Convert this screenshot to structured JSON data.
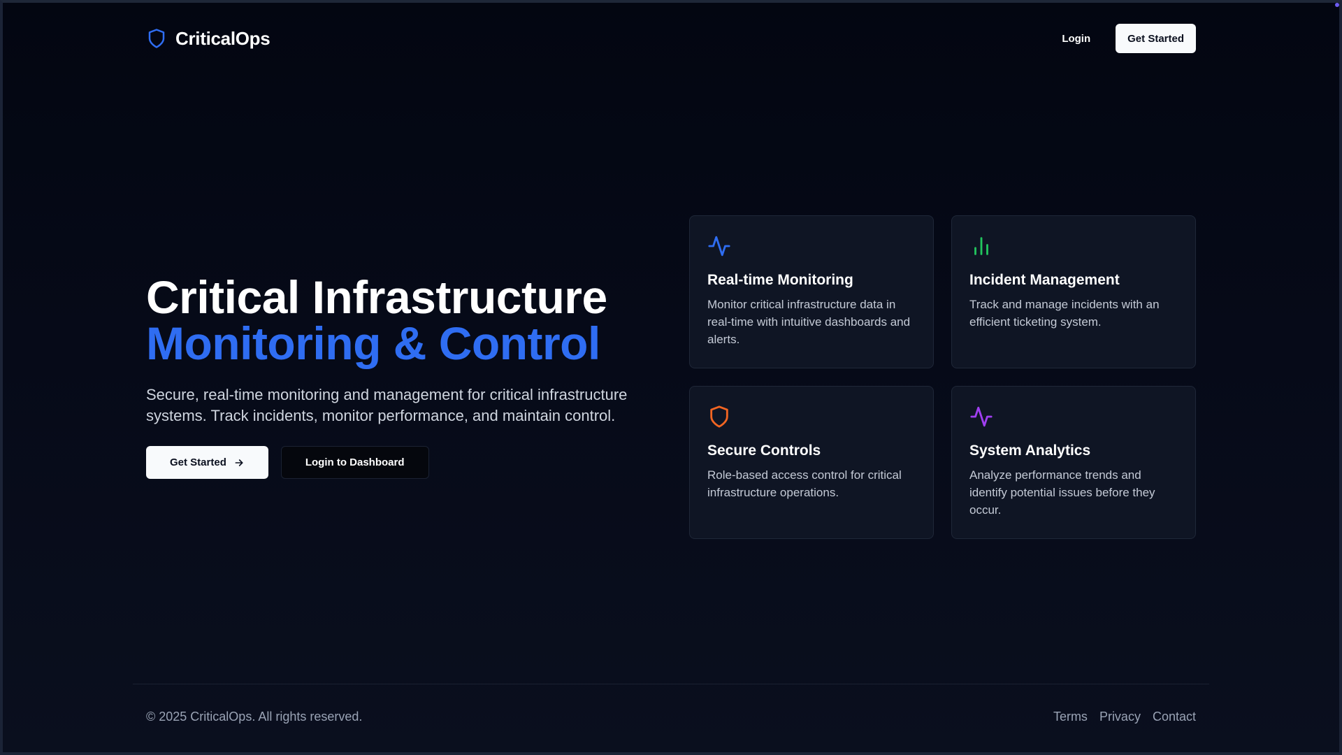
{
  "header": {
    "brand_name": "CriticalOps",
    "brand_icon": "shield-icon",
    "login_label": "Login",
    "get_started_label": "Get Started"
  },
  "hero": {
    "title_line1": "Critical Infrastructure",
    "title_line2": "Monitoring & Control",
    "subtitle": "Secure, real-time monitoring and management for critical infrastructure systems. Track incidents, monitor performance, and maintain control.",
    "primary_button": "Get Started",
    "primary_button_icon": "arrow-right-icon",
    "secondary_button": "Login to Dashboard"
  },
  "features": [
    {
      "icon": "activity-icon",
      "icon_color": "#2f6df2",
      "title": "Real-time Monitoring",
      "description": "Monitor critical infrastructure data in real-time with intuitive dashboards and alerts."
    },
    {
      "icon": "bar-chart-icon",
      "icon_color": "#22c55e",
      "title": "Incident Management",
      "description": "Track and manage incidents with an efficient ticketing system."
    },
    {
      "icon": "shield-icon",
      "icon_color": "#f26522",
      "title": "Secure Controls",
      "description": "Role-based access control for critical infrastructure operations."
    },
    {
      "icon": "activity-icon",
      "icon_color": "#a03ff0",
      "title": "System Analytics",
      "description": "Analyze performance trends and identify potential issues before they occur."
    }
  ],
  "footer": {
    "copyright": "© 2025 CriticalOps. All rights reserved.",
    "links": [
      "Terms",
      "Privacy",
      "Contact"
    ]
  },
  "colors": {
    "accent": "#2f6df2",
    "background": "#060a18",
    "card": "#0f1524"
  }
}
